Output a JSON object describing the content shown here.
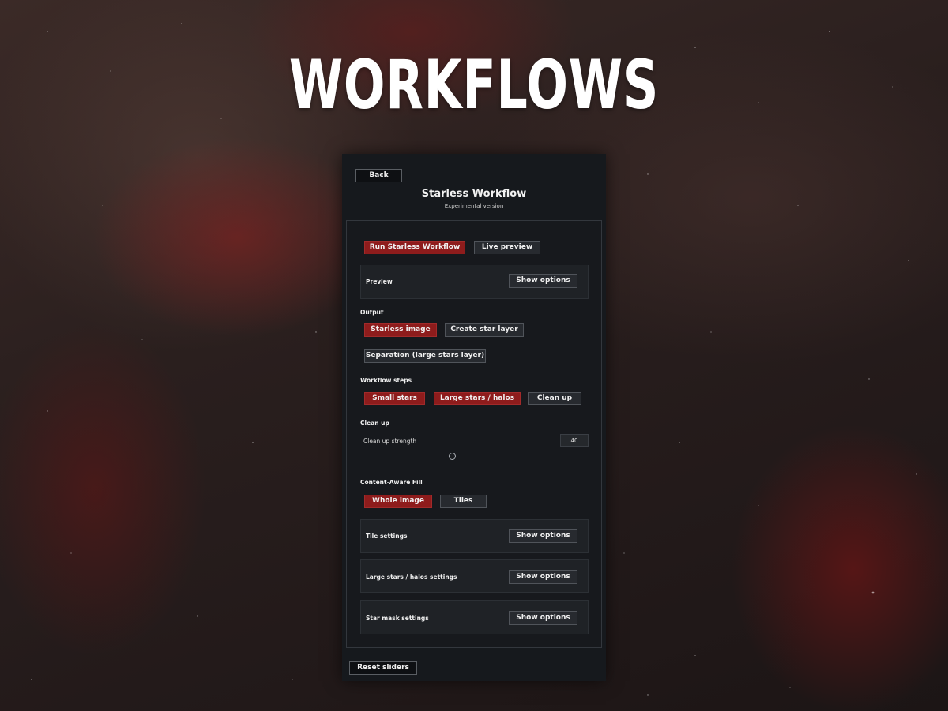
{
  "headline": "WORKFLOWS",
  "panel": {
    "back_label": "Back",
    "title": "Starless Workflow",
    "subtitle": "Experimental version",
    "run_label": "Run Starless Workflow",
    "live_preview_label": "Live preview",
    "preview": {
      "label": "Preview",
      "button": "Show options"
    },
    "output": {
      "heading": "Output",
      "starless_label": "Starless image",
      "star_layer_label": "Create star layer",
      "separation_label": "Separation (large stars layer)"
    },
    "workflow_steps": {
      "heading": "Workflow steps",
      "small_stars": "Small stars",
      "large_stars": "Large stars / halos",
      "clean_up": "Clean up"
    },
    "clean_up": {
      "heading": "Clean up",
      "strength_label": "Clean up strength",
      "strength_value": "40"
    },
    "content_aware": {
      "heading": "Content-Aware Fill",
      "whole_image": "Whole image",
      "tiles": "Tiles"
    },
    "tile_settings": {
      "label": "Tile settings",
      "button": "Show options"
    },
    "large_settings": {
      "label": "Large stars / halos settings",
      "button": "Show options"
    },
    "star_mask": {
      "label": "Star mask settings",
      "button": "Show options"
    },
    "reset_label": "Reset sliders"
  },
  "colors": {
    "accent": "#8e1c1c",
    "panel_bg": "#16191d"
  }
}
